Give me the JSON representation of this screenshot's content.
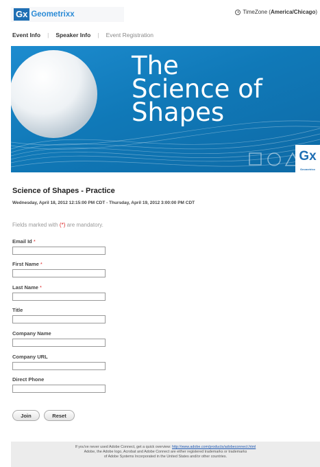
{
  "header": {
    "logo_badge": "Gx",
    "logo_text": "Geometrixx",
    "timezone_prefix": "TimeZone (",
    "timezone_value": "America/Chicago",
    "timezone_suffix": ")"
  },
  "nav": {
    "items": [
      {
        "label": "Event Info"
      },
      {
        "label": "Speaker Info"
      },
      {
        "label": "Event Registration"
      }
    ],
    "separator": "|"
  },
  "banner": {
    "title": "The\nScience of\nShapes",
    "badge": "Gx",
    "badge_caption": "Geometrixx"
  },
  "event": {
    "title": "Science of Shapes - Practice",
    "dates": "Wednesday, April 18, 2012 12:15:00 PM CDT - Thursday, April 19, 2012 3:00:00 PM CDT"
  },
  "form": {
    "mandatory_prefix": "Fields marked with ",
    "mandatory_marker": "(*)",
    "mandatory_suffix": " are mandatory.",
    "required_star": "*",
    "fields": [
      {
        "label": "Email Id",
        "value": ""
      },
      {
        "label": "First Name",
        "value": ""
      },
      {
        "label": "Last Name",
        "value": ""
      },
      {
        "label": "Title",
        "value": ""
      },
      {
        "label": "Company Name",
        "value": ""
      },
      {
        "label": "Company URL",
        "value": ""
      },
      {
        "label": "Direct Phone",
        "value": ""
      }
    ],
    "join_label": "Join",
    "reset_label": "Reset"
  },
  "footer": {
    "line1_text": "If you've never used Adobe Connect, get a quick overview: ",
    "line1_link": "http://www.adobe.com/products/adobeconnect.html",
    "line2": "Adobe, the Adobe logo, Acrobat and Adobe Connect are either registered trademarks or trademarks",
    "line3": "of Adobe Systems Incorporated in the United States and/or other countries."
  },
  "colors": {
    "brand_blue": "#1f6fb4",
    "required_red": "#dd2222",
    "banner_blue": "#1079b8"
  }
}
